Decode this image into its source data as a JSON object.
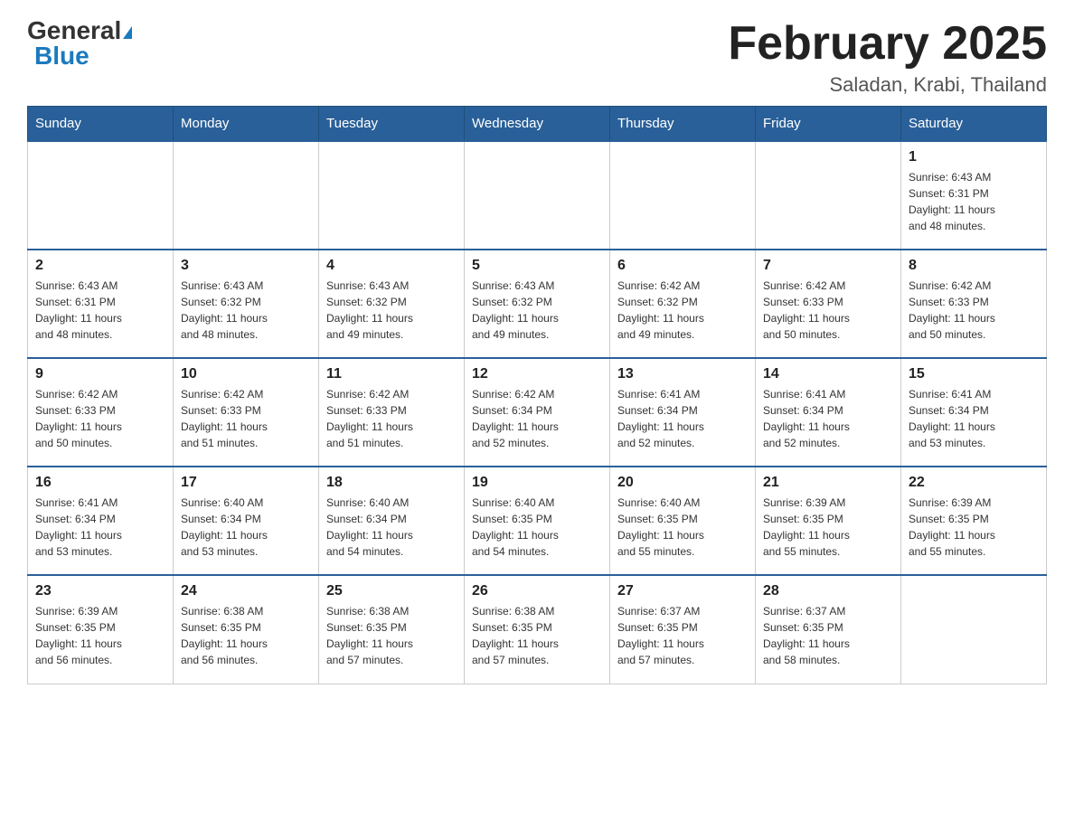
{
  "header": {
    "logo_general": "General",
    "logo_blue": "Blue",
    "month_title": "February 2025",
    "location": "Saladan, Krabi, Thailand"
  },
  "days_of_week": [
    "Sunday",
    "Monday",
    "Tuesday",
    "Wednesday",
    "Thursday",
    "Friday",
    "Saturday"
  ],
  "weeks": [
    [
      {
        "day": "",
        "info": ""
      },
      {
        "day": "",
        "info": ""
      },
      {
        "day": "",
        "info": ""
      },
      {
        "day": "",
        "info": ""
      },
      {
        "day": "",
        "info": ""
      },
      {
        "day": "",
        "info": ""
      },
      {
        "day": "1",
        "info": "Sunrise: 6:43 AM\nSunset: 6:31 PM\nDaylight: 11 hours\nand 48 minutes."
      }
    ],
    [
      {
        "day": "2",
        "info": "Sunrise: 6:43 AM\nSunset: 6:31 PM\nDaylight: 11 hours\nand 48 minutes."
      },
      {
        "day": "3",
        "info": "Sunrise: 6:43 AM\nSunset: 6:32 PM\nDaylight: 11 hours\nand 48 minutes."
      },
      {
        "day": "4",
        "info": "Sunrise: 6:43 AM\nSunset: 6:32 PM\nDaylight: 11 hours\nand 49 minutes."
      },
      {
        "day": "5",
        "info": "Sunrise: 6:43 AM\nSunset: 6:32 PM\nDaylight: 11 hours\nand 49 minutes."
      },
      {
        "day": "6",
        "info": "Sunrise: 6:42 AM\nSunset: 6:32 PM\nDaylight: 11 hours\nand 49 minutes."
      },
      {
        "day": "7",
        "info": "Sunrise: 6:42 AM\nSunset: 6:33 PM\nDaylight: 11 hours\nand 50 minutes."
      },
      {
        "day": "8",
        "info": "Sunrise: 6:42 AM\nSunset: 6:33 PM\nDaylight: 11 hours\nand 50 minutes."
      }
    ],
    [
      {
        "day": "9",
        "info": "Sunrise: 6:42 AM\nSunset: 6:33 PM\nDaylight: 11 hours\nand 50 minutes."
      },
      {
        "day": "10",
        "info": "Sunrise: 6:42 AM\nSunset: 6:33 PM\nDaylight: 11 hours\nand 51 minutes."
      },
      {
        "day": "11",
        "info": "Sunrise: 6:42 AM\nSunset: 6:33 PM\nDaylight: 11 hours\nand 51 minutes."
      },
      {
        "day": "12",
        "info": "Sunrise: 6:42 AM\nSunset: 6:34 PM\nDaylight: 11 hours\nand 52 minutes."
      },
      {
        "day": "13",
        "info": "Sunrise: 6:41 AM\nSunset: 6:34 PM\nDaylight: 11 hours\nand 52 minutes."
      },
      {
        "day": "14",
        "info": "Sunrise: 6:41 AM\nSunset: 6:34 PM\nDaylight: 11 hours\nand 52 minutes."
      },
      {
        "day": "15",
        "info": "Sunrise: 6:41 AM\nSunset: 6:34 PM\nDaylight: 11 hours\nand 53 minutes."
      }
    ],
    [
      {
        "day": "16",
        "info": "Sunrise: 6:41 AM\nSunset: 6:34 PM\nDaylight: 11 hours\nand 53 minutes."
      },
      {
        "day": "17",
        "info": "Sunrise: 6:40 AM\nSunset: 6:34 PM\nDaylight: 11 hours\nand 53 minutes."
      },
      {
        "day": "18",
        "info": "Sunrise: 6:40 AM\nSunset: 6:34 PM\nDaylight: 11 hours\nand 54 minutes."
      },
      {
        "day": "19",
        "info": "Sunrise: 6:40 AM\nSunset: 6:35 PM\nDaylight: 11 hours\nand 54 minutes."
      },
      {
        "day": "20",
        "info": "Sunrise: 6:40 AM\nSunset: 6:35 PM\nDaylight: 11 hours\nand 55 minutes."
      },
      {
        "day": "21",
        "info": "Sunrise: 6:39 AM\nSunset: 6:35 PM\nDaylight: 11 hours\nand 55 minutes."
      },
      {
        "day": "22",
        "info": "Sunrise: 6:39 AM\nSunset: 6:35 PM\nDaylight: 11 hours\nand 55 minutes."
      }
    ],
    [
      {
        "day": "23",
        "info": "Sunrise: 6:39 AM\nSunset: 6:35 PM\nDaylight: 11 hours\nand 56 minutes."
      },
      {
        "day": "24",
        "info": "Sunrise: 6:38 AM\nSunset: 6:35 PM\nDaylight: 11 hours\nand 56 minutes."
      },
      {
        "day": "25",
        "info": "Sunrise: 6:38 AM\nSunset: 6:35 PM\nDaylight: 11 hours\nand 57 minutes."
      },
      {
        "day": "26",
        "info": "Sunrise: 6:38 AM\nSunset: 6:35 PM\nDaylight: 11 hours\nand 57 minutes."
      },
      {
        "day": "27",
        "info": "Sunrise: 6:37 AM\nSunset: 6:35 PM\nDaylight: 11 hours\nand 57 minutes."
      },
      {
        "day": "28",
        "info": "Sunrise: 6:37 AM\nSunset: 6:35 PM\nDaylight: 11 hours\nand 58 minutes."
      },
      {
        "day": "",
        "info": ""
      }
    ]
  ]
}
